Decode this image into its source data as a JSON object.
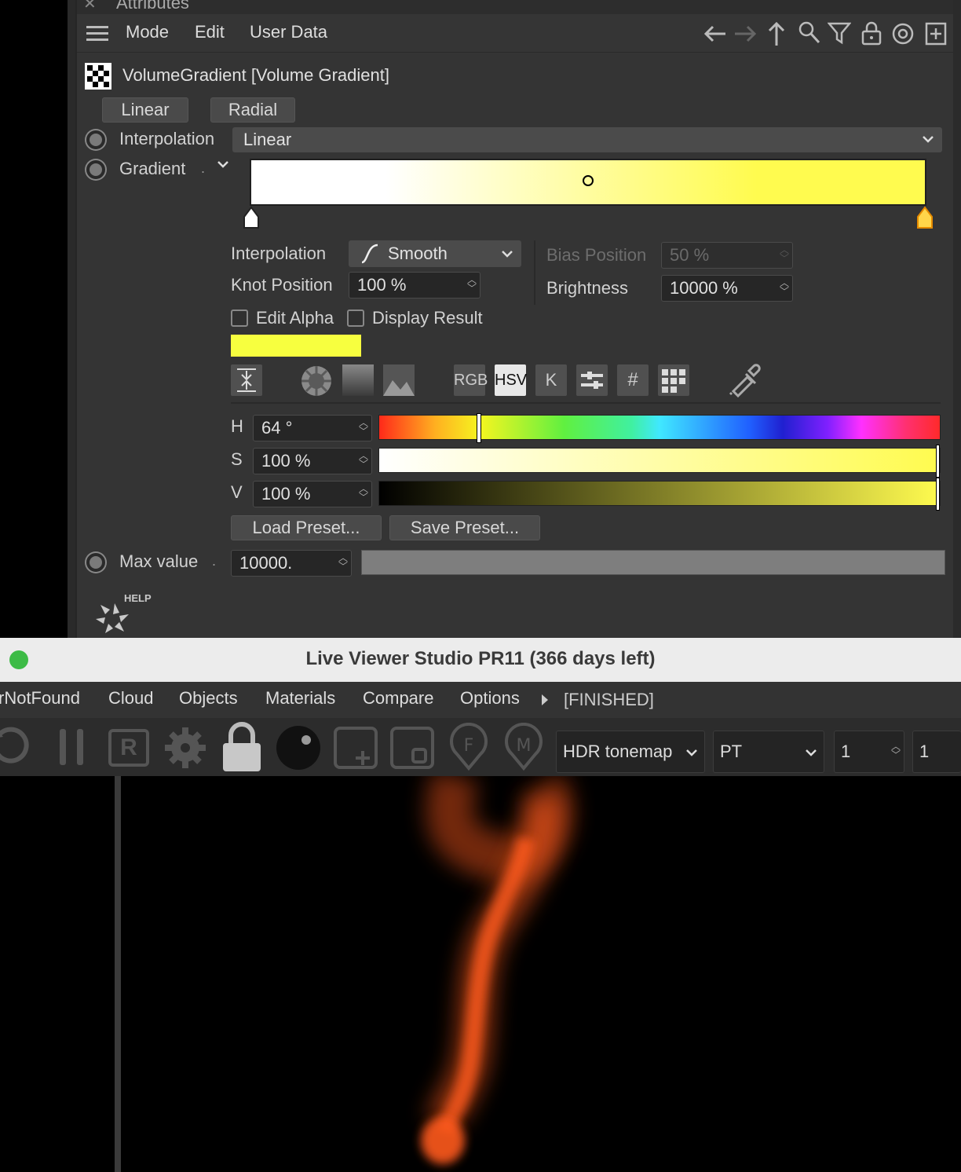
{
  "attributes": {
    "title": "Attributes",
    "menu": {
      "mode": "Mode",
      "edit": "Edit",
      "user_data": "User Data"
    },
    "object_title": "VolumeGradient [Volume Gradient]",
    "tabs": {
      "linear": "Linear",
      "radial": "Radial"
    },
    "interpolation": {
      "label": "Interpolation",
      "value": "Linear"
    },
    "gradient": {
      "label": "Gradient",
      "start_color": "#ffffff",
      "end_color": "#fffb4f",
      "mid_knot": 0.5,
      "knot_interpolation_label": "Interpolation",
      "knot_interpolation_value": "Smooth",
      "knot_position_label": "Knot Position",
      "knot_position_value": "100 %",
      "bias_position_label": "Bias Position",
      "bias_position_value": "50 %",
      "brightness_label": "Brightness",
      "brightness_value": "10000 %",
      "edit_alpha_label": "Edit Alpha",
      "display_result_label": "Display Result",
      "swatch_color": "#f7ff3f"
    },
    "color_modes": {
      "rgb": "RGB",
      "hsv": "HSV",
      "k": "K",
      "hash": "#"
    },
    "hsv": {
      "h_label": "H",
      "h_value": "64 °",
      "h_fraction": 0.178,
      "s_label": "S",
      "s_value": "100 %",
      "s_fraction": 1.0,
      "v_label": "V",
      "v_value": "100 %",
      "v_fraction": 1.0
    },
    "presets": {
      "load": "Load Preset...",
      "save": "Save Preset..."
    },
    "max_value": {
      "label": "Max value",
      "value": "10000."
    },
    "help_label": "HELP"
  },
  "live_viewer": {
    "title": "Live Viewer Studio PR11 (366 days left)",
    "menu": {
      "first": "rNotFound",
      "cloud": "Cloud",
      "objects": "Objects",
      "materials": "Materials",
      "compare": "Compare",
      "options": "Options",
      "status": "[FINISHED]"
    },
    "toolbar": {
      "r_label": "R",
      "f_label": "F",
      "m_label": "M",
      "tonemap": "HDR tonemap",
      "kernel": "PT",
      "value1": "1",
      "value2": "1"
    },
    "traffic_light_color": "#3dbb46",
    "smoke_color": "#ff5a1e"
  }
}
